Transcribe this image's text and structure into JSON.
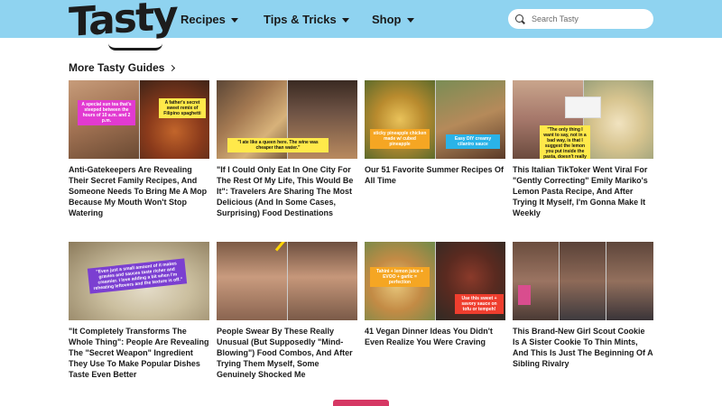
{
  "header": {
    "logo": "Tasty",
    "nav": [
      {
        "label": "Recipes"
      },
      {
        "label": "Tips & Tricks"
      },
      {
        "label": "Shop"
      }
    ],
    "search_placeholder": "Search Tasty"
  },
  "section": {
    "title": "More Tasty Guides"
  },
  "cards": [
    {
      "title": "Anti-Gatekeepers Are Revealing Their Secret Family Recipes, And Someone Needs To Bring Me A Mop Because My Mouth Won't Stop Watering",
      "captions": [
        "A special sun tea that's steeped between the hours of 10 a.m. and 2 p.m.",
        "A father's secret sweet remix of Filipino spaghetti"
      ]
    },
    {
      "title": "\"If I Could Only Eat In One City For The Rest Of My Life, This Would Be It\": Travelers Are Sharing The Most Delicious (And In Some Cases, Surprising) Food Destinations",
      "captions": [
        "\"I ate like a queen here. The wine was cheaper than water.\""
      ]
    },
    {
      "title": "Our 51 Favorite Summer Recipes Of All Time",
      "captions": [
        "sticky pineapple chicken made w/ cubed pineapple",
        "Easy DIY creamy cilantro sauce"
      ]
    },
    {
      "title": "This Italian TikToker Went Viral For \"Gently Correcting\" Emily Mariko's Lemon Pasta Recipe, And After Trying It Myself, I'm Gonna Make It Weekly",
      "captions": [
        "\"The only thing I want to say, not in a bad way, is that I suggest the lemon you put inside the pasta, doesn't really make sense\""
      ]
    },
    {
      "title": "\"It Completely Transforms The Whole Thing\": People Are Revealing The \"Secret Weapon\" Ingredient They Use To Make Popular Dishes Taste Even Better",
      "captions": [
        "\"Even just a small amount of it makes gravies and sauces taste richer and creamier. I love adding a bit when I'm reheating leftovers and the texture is off.\""
      ]
    },
    {
      "title": "People Swear By These Really Unusual (But Supposedly \"Mind-Blowing\") Food Combos, And After Trying Them Myself, Some Genuinely Shocked Me",
      "captions": []
    },
    {
      "title": "41 Vegan Dinner Ideas You Didn't Even Realize You Were Craving",
      "captions": [
        "Tahini + lemon juice + EVOO + garlic = perfection",
        "Use this sweet + savory sauce on tofu or tempeh!"
      ]
    },
    {
      "title": "This Brand-New Girl Scout Cookie Is A Sister Cookie To Thin Mints, And This Is Just The Beginning Of A Sibling Rivalry",
      "captions": []
    }
  ],
  "colors": {
    "header_bg": "#8fd3f0",
    "accent_button": "#d63864",
    "title_text": "#1a1a1a"
  },
  "icons": [
    "search-icon",
    "caret-down-icon",
    "chevron-right-icon"
  ]
}
